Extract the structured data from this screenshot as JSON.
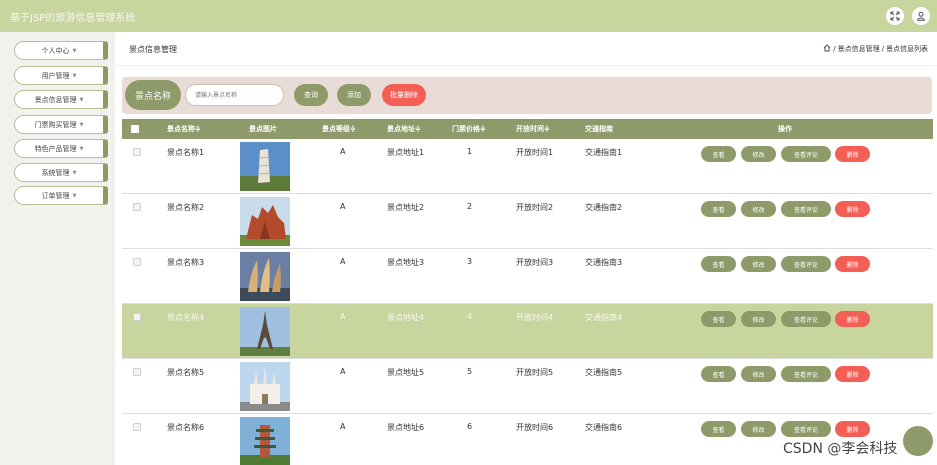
{
  "header": {
    "title": "基于JSP的旅游信息管理系统",
    "icons": [
      "fullscreen-icon",
      "user-icon"
    ]
  },
  "sidebar": {
    "items": [
      {
        "label": "个人中心"
      },
      {
        "label": "用户管理"
      },
      {
        "label": "景点信息管理"
      },
      {
        "label": "门票购买管理"
      },
      {
        "label": "特色产品管理"
      },
      {
        "label": "系统管理"
      },
      {
        "label": "订单管理"
      }
    ]
  },
  "content": {
    "page_title": "景点信息管理",
    "breadcrumb": [
      "景点信息管理",
      "景点信息列表"
    ]
  },
  "search": {
    "label": "景点名称",
    "placeholder": "请输入景点名称",
    "query_button": "查询",
    "add_button": "添加",
    "batch_delete_button": "批量删除"
  },
  "table": {
    "columns": [
      "景点名称",
      "景点图片",
      "景点等级",
      "景点地址",
      "门票价格",
      "开放时间",
      "交通指南",
      "操作"
    ],
    "sort_marker": "≑",
    "actions": [
      "查看",
      "修改",
      "查看评论",
      "删除"
    ],
    "rows": [
      {
        "name": "景点名称1",
        "image": "leaning-tower-photo",
        "level": "A",
        "address": "景点地址1",
        "price": "1",
        "hours": "开放时间1",
        "traffic": "交通指南1"
      },
      {
        "name": "景点名称2",
        "image": "red-rock-temple-photo",
        "level": "A",
        "address": "景点地址2",
        "price": "2",
        "hours": "开放时间2",
        "traffic": "交通指南2"
      },
      {
        "name": "景点名称3",
        "image": "sail-towers-photo",
        "level": "A",
        "address": "景点地址3",
        "price": "3",
        "hours": "开放时间3",
        "traffic": "交通指南3"
      },
      {
        "name": "景点名称4",
        "image": "eiffel-tower-photo",
        "level": "A",
        "address": "景点地址4",
        "price": "4",
        "hours": "开放时间4",
        "traffic": "交通指南4",
        "highlighted": true
      },
      {
        "name": "景点名称5",
        "image": "white-cathedral-photo",
        "level": "A",
        "address": "景点地址5",
        "price": "5",
        "hours": "开放时间5",
        "traffic": "交通指南5"
      },
      {
        "name": "景点名称6",
        "image": "pagoda-tower-photo",
        "level": "A",
        "address": "景点地址6",
        "price": "6",
        "hours": "开放时间6",
        "traffic": "交通指南6"
      }
    ]
  },
  "colors": {
    "topbar": "#c9d59f",
    "olive_button": "#8e9a6a",
    "danger_button": "#f35f55",
    "search_panel": "#e9dcd6",
    "row_highlight": "#c9d59f"
  },
  "watermark": "CSDN @李会科技"
}
